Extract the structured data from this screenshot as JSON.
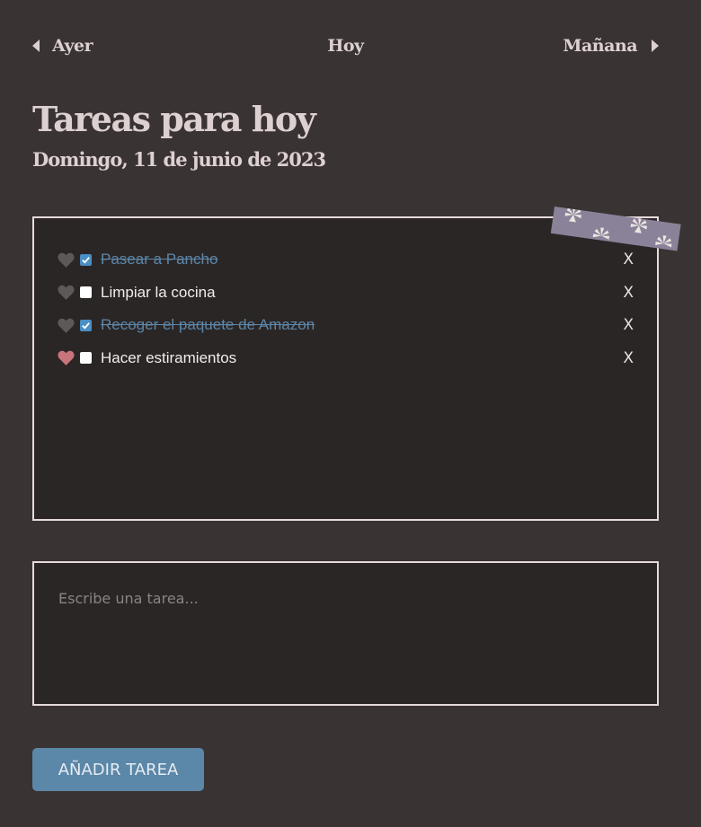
{
  "nav": {
    "prev_label": "Ayer",
    "today_label": "Hoy",
    "next_label": "Mañana"
  },
  "header": {
    "title": "Tareas para hoy",
    "date": "Domingo, 11 de junio de 2023"
  },
  "tasks": [
    {
      "text": "Pasear a Pancho",
      "done": true,
      "favorite": false,
      "delete_label": "X"
    },
    {
      "text": "Limpiar la cocina",
      "done": false,
      "favorite": false,
      "delete_label": "X"
    },
    {
      "text": "Recoger el paquete de Amazon",
      "done": true,
      "favorite": false,
      "delete_label": "X"
    },
    {
      "text": "Hacer estiramientos",
      "done": false,
      "favorite": true,
      "delete_label": "X"
    }
  ],
  "new_task": {
    "placeholder": "Escribe una tarea...",
    "value": ""
  },
  "add_button": {
    "label": "AÑADIR TAREA"
  },
  "colors": {
    "background": "#3a3333",
    "panel": "#2b2626",
    "heart_favorite": "#c9747a",
    "heart_default": "#5e5959",
    "done_text": "#5c86a8",
    "checkbox_checked": "#4a8fc4",
    "button": "#5b87a8",
    "tape": "#8a8299"
  },
  "icons": {
    "prev": "triangle-left-icon",
    "next": "triangle-right-icon",
    "favorite": "heart-icon",
    "check": "checkmark-icon",
    "tape_pattern": "flower-icon"
  }
}
